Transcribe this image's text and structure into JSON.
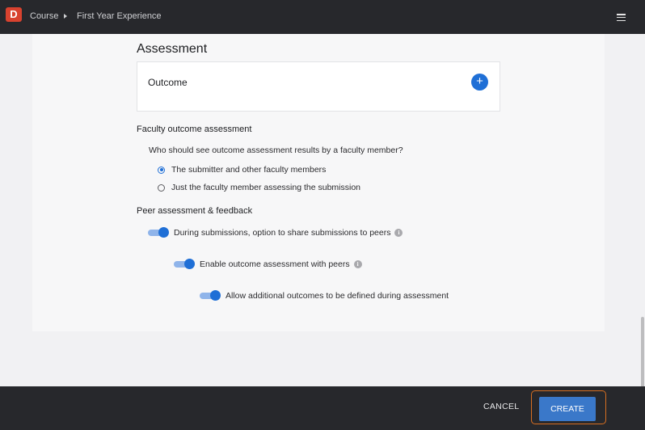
{
  "header": {
    "logo_letter": "D",
    "breadcrumb": [
      "Course",
      "First Year Experience"
    ],
    "menu_icon": "hamburger-menu-icon"
  },
  "assessment": {
    "title": "Assessment",
    "outcome_label": "Outcome",
    "add_icon": "+"
  },
  "faculty": {
    "heading": "Faculty outcome assessment",
    "question": "Who should see outcome assessment results by a faculty member?",
    "options": [
      {
        "label": "The submitter and other faculty members",
        "selected": true
      },
      {
        "label": "Just the faculty member assessing the submission",
        "selected": false
      }
    ]
  },
  "peer": {
    "heading": "Peer assessment & feedback",
    "toggles": [
      {
        "label": "During submissions, option to share submissions to peers",
        "on": true,
        "info": true
      },
      {
        "label": "Enable outcome assessment with peers",
        "on": true,
        "info": true
      },
      {
        "label": "Allow additional outcomes to be defined during assessment",
        "on": true,
        "info": false
      }
    ]
  },
  "footer": {
    "cancel_label": "CANCEL",
    "create_label": "CREATE"
  },
  "colors": {
    "accent": "#1f6fd6",
    "topbar": "#27282c",
    "logo": "#d8422f",
    "highlight": "#d86f21"
  }
}
